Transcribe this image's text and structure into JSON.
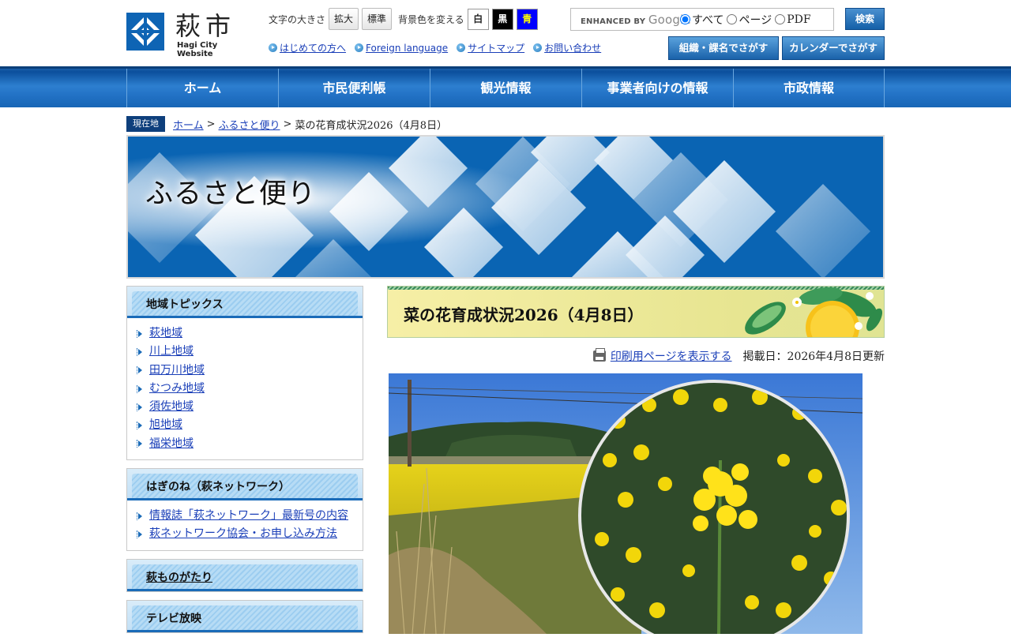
{
  "header": {
    "logo_title": "萩市",
    "logo_sub": "Hagi City Website",
    "font_size_label": "文字の大きさ",
    "font_size_buttons": [
      "拡大",
      "標準"
    ],
    "bg_color_label": "背景色を変える",
    "bg_color_buttons": [
      "白",
      "黒",
      "青"
    ],
    "links": [
      "はじめての方へ",
      "Foreign language",
      "サイトマップ",
      "お問い合わせ"
    ],
    "search": {
      "enhanced_by": "ENHANCED BY",
      "google": "Google",
      "radio_options": [
        "すべて",
        "ページ",
        "PDF"
      ],
      "selected": "すべて",
      "button_label": "検索"
    },
    "org_button": "組織・課名でさがす",
    "calendar_button": "カレンダーでさがす"
  },
  "gnav": [
    "ホーム",
    "市民便利帳",
    "観光情報",
    "事業者向けの情報",
    "市政情報"
  ],
  "breadcrumb": {
    "tag": "現在地",
    "items": [
      "ホーム",
      "ふるさと便り",
      "菜の花育成状況2026（4月8日）"
    ]
  },
  "banner": {
    "title": "ふるさと便り"
  },
  "sidebar": {
    "boxes": [
      {
        "title": "地域トピックス",
        "items": [
          "萩地域",
          "川上地域",
          "田万川地域",
          "むつみ地域",
          "須佐地域",
          "旭地域",
          "福栄地域"
        ]
      },
      {
        "title": "はぎのね（萩ネットワーク）",
        "items": [
          "情報誌「萩ネットワーク」最新号の内容",
          "萩ネットワーク協会・お申し込み方法"
        ]
      },
      {
        "title": "萩ものがたり",
        "items": []
      },
      {
        "title": "テレビ放映",
        "items": []
      }
    ]
  },
  "main": {
    "title": "菜の花育成状況2026（4月8日）",
    "print_link": "印刷用ページを表示する",
    "updated": "掲載日：2026年4月8日更新"
  },
  "colors": {
    "nav_blue": "#1a6bb8",
    "banner_blue": "#0a64b3",
    "link": "#1a3fb8"
  }
}
